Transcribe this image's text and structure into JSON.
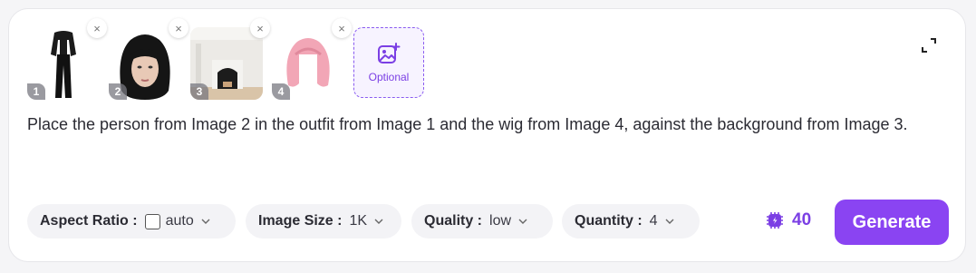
{
  "images": [
    {
      "number": "1",
      "icon": "outfit-thumbnail",
      "remove_glyph": "×"
    },
    {
      "number": "2",
      "icon": "person-thumbnail",
      "remove_glyph": "×"
    },
    {
      "number": "3",
      "icon": "background-thumbnail",
      "remove_glyph": "×"
    },
    {
      "number": "4",
      "icon": "wig-thumbnail",
      "remove_glyph": "×"
    }
  ],
  "optional_upload": {
    "label": "Optional",
    "icon": "add-image-icon"
  },
  "expand_icon": "expand-icon",
  "prompt": {
    "text": "Place the person from Image 2 in the outfit from Image 1 and the wig from Image 4, against the background from Image 3."
  },
  "settings": {
    "aspect_ratio": {
      "label": "Aspect Ratio :",
      "value": "auto"
    },
    "image_size": {
      "label": "Image Size :",
      "value": "1K"
    },
    "quality": {
      "label": "Quality :",
      "value": "low"
    },
    "quantity": {
      "label": "Quantity :",
      "value": "4"
    }
  },
  "credits": {
    "value": "40",
    "icon": "chip-credit-icon"
  },
  "generate_button": {
    "label": "Generate"
  },
  "colors": {
    "accent": "#8a44f2",
    "accent_text": "#7b3fe4",
    "pill_bg": "#f3f3f6"
  }
}
